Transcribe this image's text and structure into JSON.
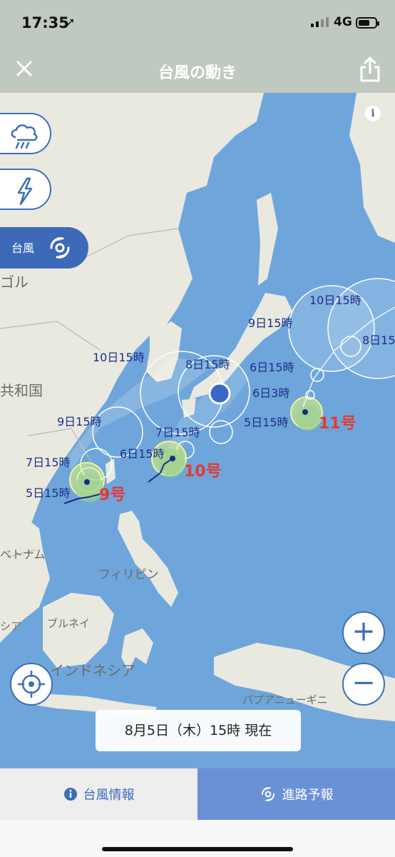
{
  "status_bar": {
    "time": "17:35",
    "network": "4G",
    "battery_level": 0.7
  },
  "nav": {
    "title": "台風の動き",
    "close_icon": "close-icon",
    "share_icon": "share-icon"
  },
  "side_buttons": {
    "rain_icon": "rain-cloud-icon",
    "lightning_icon": "lightning-icon",
    "typhoon_label": "台風",
    "typhoon_icon": "typhoon-icon"
  },
  "map": {
    "place_labels": {
      "mongolia": "ゴル",
      "china": "共和国",
      "vietnam": "ベトナム",
      "philippines": "フィリピン",
      "cambodia": "シア",
      "brunei": "ブルネイ",
      "indonesia": "インドネシア",
      "papua": "パプアニューギニ"
    },
    "typhoons": [
      {
        "name": "9号",
        "color": "#e53935"
      },
      {
        "name": "10号",
        "color": "#e53935"
      },
      {
        "name": "11号",
        "color": "#e53935"
      }
    ],
    "forecast_labels": {
      "t9_5d": "5日15時",
      "t9_7d": "7日15時",
      "t9_9d": "9日15時",
      "t9_10d": "10日15時",
      "t10_6d": "6日15時",
      "t10_7d": "7日15時",
      "t10_8d": "8日15時",
      "t11_5d": "5日15時",
      "t11_6d3": "6日3時",
      "t11_6d": "6日15時",
      "t11_9d": "9日15時",
      "t11_10d": "10日15時",
      "t11_8d": "8日15"
    },
    "current_location_color": "#3a67c8"
  },
  "controls": {
    "zoom_in": "+",
    "zoom_out": "−",
    "locate_icon": "crosshair-icon",
    "info_icon": "info-icon"
  },
  "timestamp": "8月5日（木）15時 現在",
  "tabs": {
    "info": "台風情報",
    "forecast": "進路予報"
  }
}
